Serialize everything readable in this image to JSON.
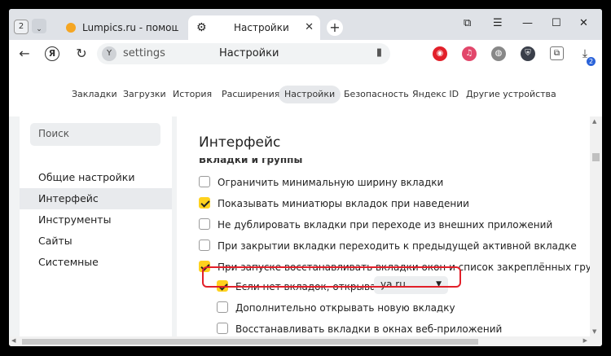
{
  "tabs": {
    "count": "2",
    "items": [
      {
        "title": "Lumpics.ru - помощь с ко"
      },
      {
        "title": "Настройки"
      }
    ]
  },
  "address": {
    "url": "settings",
    "title": "Настройки"
  },
  "extensions": {
    "download_badge": "2"
  },
  "topnav": {
    "items": [
      "Закладки",
      "Загрузки",
      "История",
      "Расширения",
      "Настройки",
      "Безопасность",
      "Яндекс ID",
      "Другие устройства"
    ],
    "active": "Настройки"
  },
  "sidebar": {
    "search_placeholder": "Поиск",
    "items": [
      "Общие настройки",
      "Интерфейс",
      "Инструменты",
      "Сайты",
      "Системные"
    ],
    "active": "Интерфейс"
  },
  "main": {
    "title": "Интерфейс",
    "section": "Вкладки и группы",
    "options": [
      {
        "label": "Ограничить минимальную ширину вкладки",
        "checked": false
      },
      {
        "label": "Показывать миниатюры вкладок при наведении",
        "checked": true
      },
      {
        "label": "Не дублировать вкладки при переходе из внешних приложений",
        "checked": false
      },
      {
        "label": "При закрытии вкладки переходить к предыдущей активной вкладке",
        "checked": false
      },
      {
        "label": "При запуске восстанавливать вкладки окон и список закреплённых групп",
        "checked": true
      }
    ],
    "sub_options": [
      {
        "label": "Если нет вкладок, открывать",
        "checked": true,
        "select_value": "ya.ru"
      },
      {
        "label": "Дополнительно открывать новую вкладку",
        "checked": false
      },
      {
        "label": "Восстанавливать вкладки в окнах веб-приложений",
        "checked": false
      }
    ]
  },
  "colors": {
    "accent": "#ffd21e",
    "highlight": "#e2202a"
  }
}
